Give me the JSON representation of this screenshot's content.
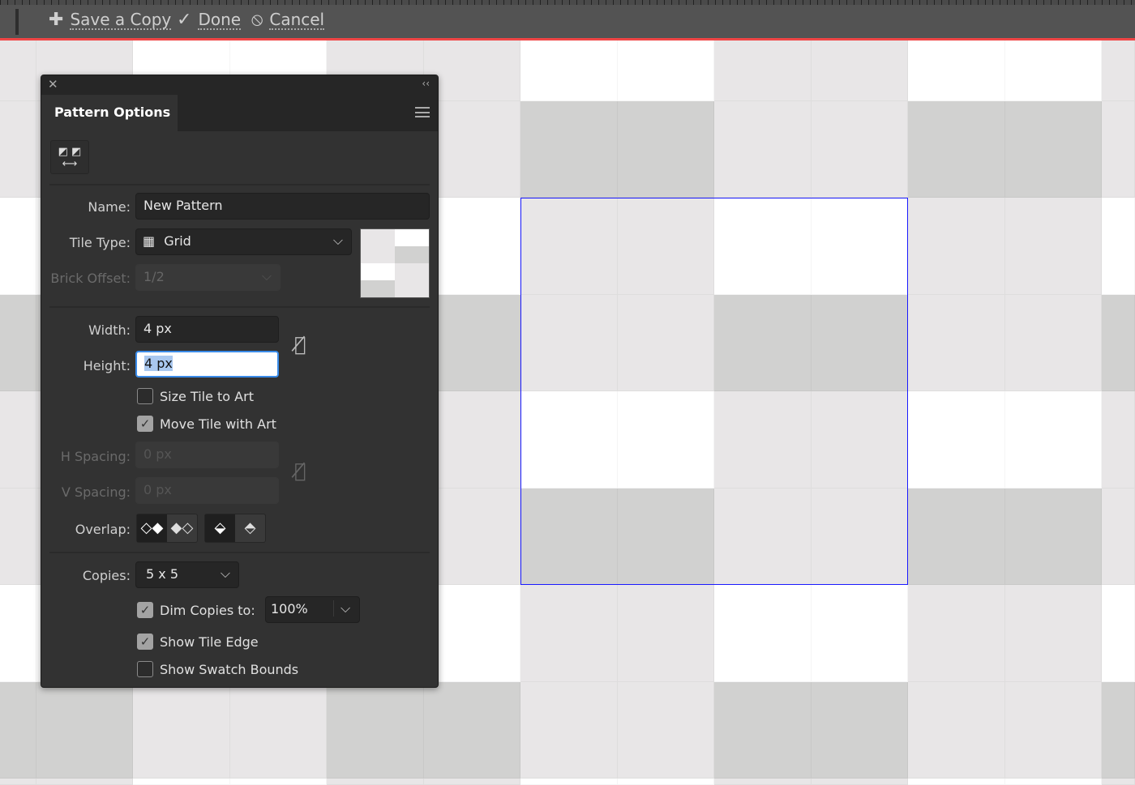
{
  "toolbar": {
    "save_copy": "Save a Copy",
    "done": "Done",
    "cancel": "Cancel",
    "accent_color": "#f04545"
  },
  "panel": {
    "title": "Pattern Options",
    "name_label": "Name:",
    "name_value": "New Pattern",
    "tile_type_label": "Tile Type:",
    "tile_type_value": "Grid",
    "brick_offset_label": "Brick Offset:",
    "brick_offset_value": "1/2",
    "width_label": "Width:",
    "width_value": "4 px",
    "height_label": "Height:",
    "height_value": "4 px",
    "size_tile_to_art": {
      "label": "Size Tile to Art",
      "checked": false
    },
    "move_tile_with_art": {
      "label": "Move Tile with Art",
      "checked": true
    },
    "h_spacing_label": "H Spacing:",
    "h_spacing_value": "0 px",
    "v_spacing_label": "V Spacing:",
    "v_spacing_value": "0 px",
    "overlap_label": "Overlap:",
    "copies_label": "Copies:",
    "copies_value": "5 x 5",
    "dim_copies": {
      "label": "Dim Copies to:",
      "checked": true,
      "value": "100%"
    },
    "show_tile_edge": {
      "label": "Show Tile Edge",
      "checked": true
    },
    "show_swatch_bounds": {
      "label": "Show Swatch Bounds",
      "checked": false
    }
  },
  "pattern": {
    "colors": {
      "w": "#ffffff",
      "l": "#e8e6e7",
      "d": "#d1d1d0"
    },
    "cells": [
      [
        "l",
        "l",
        "w",
        "w"
      ],
      [
        "l",
        "l",
        "d",
        "d"
      ],
      [
        "w",
        "w",
        "l",
        "l"
      ],
      [
        "d",
        "d",
        "l",
        "l"
      ]
    ],
    "tile_edge_color": "#1a1aff"
  }
}
